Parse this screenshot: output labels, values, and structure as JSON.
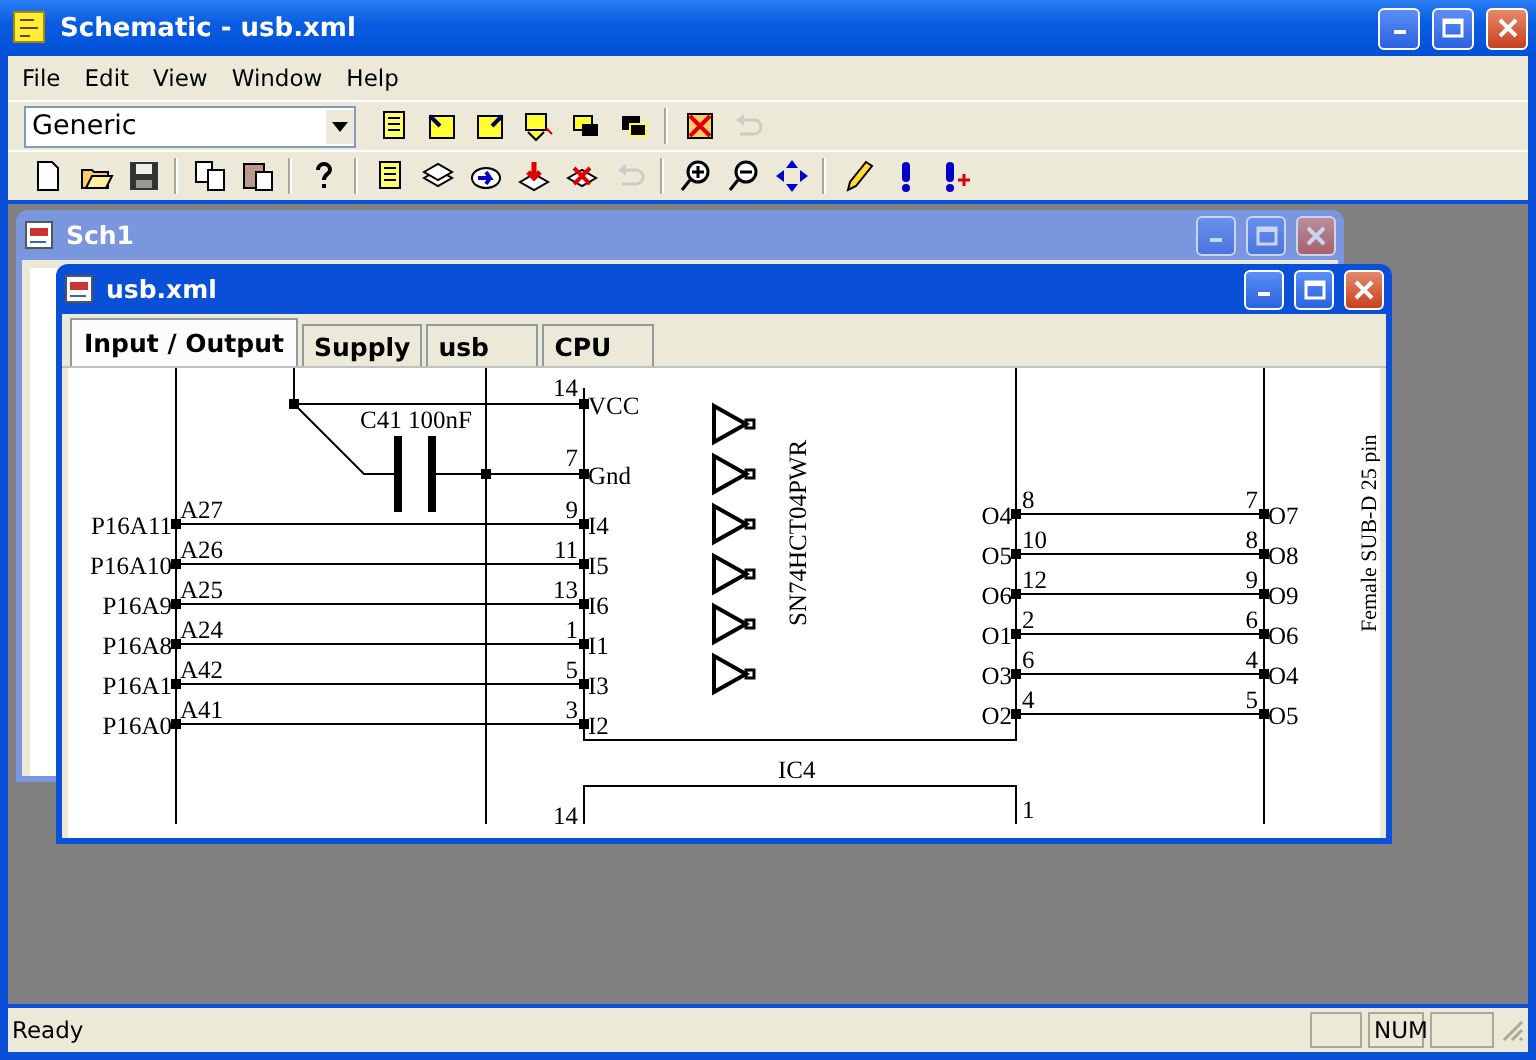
{
  "window": {
    "title": "Schematic - usb.xml"
  },
  "menu": [
    "File",
    "Edit",
    "View",
    "Window",
    "Help"
  ],
  "toolbar_top": {
    "preset": "Generic",
    "buttons": [
      {
        "kind": "document",
        "disabled": false
      },
      {
        "kind": "corner-in",
        "disabled": false
      },
      {
        "kind": "corner-out",
        "disabled": false
      },
      {
        "kind": "swap",
        "disabled": false
      },
      {
        "kind": "front",
        "disabled": false
      },
      {
        "kind": "back",
        "disabled": false
      },
      {
        "kind": "sep"
      },
      {
        "kind": "delete",
        "disabled": false
      },
      {
        "kind": "undo",
        "disabled": true
      }
    ]
  },
  "toolbar_bottom": {
    "buttons": [
      {
        "kind": "new",
        "disabled": false
      },
      {
        "kind": "open",
        "disabled": false
      },
      {
        "kind": "save",
        "disabled": false
      },
      {
        "kind": "sep"
      },
      {
        "kind": "copy",
        "disabled": false
      },
      {
        "kind": "paste",
        "disabled": false
      },
      {
        "kind": "sep"
      },
      {
        "kind": "help",
        "disabled": false
      },
      {
        "kind": "sep"
      },
      {
        "kind": "document",
        "disabled": false
      },
      {
        "kind": "stack",
        "disabled": false
      },
      {
        "kind": "arrow",
        "disabled": false
      },
      {
        "kind": "download",
        "disabled": false
      },
      {
        "kind": "remove",
        "disabled": false
      },
      {
        "kind": "undo",
        "disabled": true
      },
      {
        "kind": "sep"
      },
      {
        "kind": "zoom-in",
        "disabled": false
      },
      {
        "kind": "zoom-out",
        "disabled": false
      },
      {
        "kind": "move",
        "disabled": false
      },
      {
        "kind": "sep"
      },
      {
        "kind": "pencil",
        "disabled": false
      },
      {
        "kind": "exclaim",
        "disabled": false
      },
      {
        "kind": "exclaim-plus",
        "disabled": false
      }
    ]
  },
  "back_window": {
    "title": "Sch1"
  },
  "front_window": {
    "title": "usb.xml",
    "tabs": [
      {
        "label": "Input / Output",
        "selected": true
      },
      {
        "label": "Supply",
        "selected": false
      },
      {
        "label": "usb",
        "selected": false
      },
      {
        "label": "CPU",
        "selected": false
      }
    ],
    "schematic": {
      "capacitor_label": "C41 100nF",
      "power_pins": [
        {
          "number": "14",
          "name": "VCC"
        },
        {
          "number": "7",
          "name": "Gnd"
        }
      ],
      "input_rows": [
        {
          "port": "P16A11",
          "net": "A27",
          "pin": "9",
          "name": "I4"
        },
        {
          "port": "P16A10",
          "net": "A26",
          "pin": "11",
          "name": "I5"
        },
        {
          "port": "P16A9",
          "net": "A25",
          "pin": "13",
          "name": "I6"
        },
        {
          "port": "P16A8",
          "net": "A24",
          "pin": "1",
          "name": "I1"
        },
        {
          "port": "P16A1",
          "net": "A42",
          "pin": "5",
          "name": "I3"
        },
        {
          "port": "P16A0",
          "net": "A41",
          "pin": "3",
          "name": "I2"
        }
      ],
      "chip_part": "SN74HCT04PWR",
      "output_rows": [
        {
          "name": "O4",
          "pin": "8",
          "far_pin": "7",
          "far_name": "O7"
        },
        {
          "name": "O5",
          "pin": "10",
          "far_pin": "8",
          "far_name": "O8"
        },
        {
          "name": "O6",
          "pin": "12",
          "far_pin": "9",
          "far_name": "O9"
        },
        {
          "name": "O1",
          "pin": "2",
          "far_pin": "6",
          "far_name": "O6"
        },
        {
          "name": "O3",
          "pin": "6",
          "far_pin": "4",
          "far_name": "O4"
        },
        {
          "name": "O2",
          "pin": "4",
          "far_pin": "5",
          "far_name": "O5"
        }
      ],
      "chip_name": "IC4",
      "lower_pins": [
        {
          "number": "14"
        },
        {
          "number": "1"
        }
      ],
      "connector_label": "Female SUB-D 25 pin"
    }
  },
  "status_bar": {
    "message": "Ready",
    "indicators": [
      "NUM"
    ]
  }
}
